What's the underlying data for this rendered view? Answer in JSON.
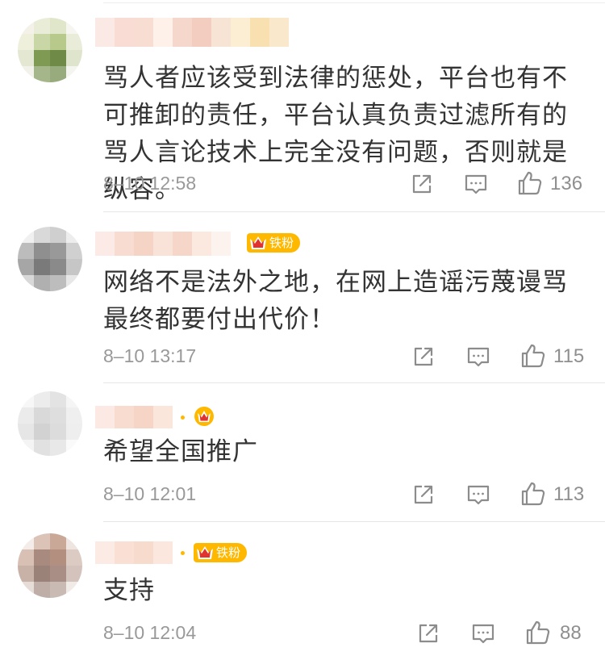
{
  "comments": [
    {
      "text": "骂人者应该受到法律的惩处，平台也有不可推卸的责任，平台认真负责过滤所有的骂人言论技术上完全没有问题，否则就是纵容。",
      "time": "8–10 12:58",
      "likes": "136",
      "badge": ""
    },
    {
      "text": "网络不是法外之地，在网上造谣污蔑谩骂最终都要付出代价！",
      "time": "8–10 13:17",
      "likes": "115",
      "badge": "铁粉"
    },
    {
      "text": "希望全国推广",
      "time": "8–10 12:01",
      "likes": "113",
      "badge": ""
    },
    {
      "text": "支持",
      "time": "8–10 12:04",
      "likes": "88",
      "badge": "铁粉"
    }
  ],
  "icons": {
    "share": "share-icon",
    "comment": "comment-icon",
    "like": "thumbs-up-icon",
    "crown": "crown-badge-icon"
  },
  "colors": {
    "text": "#333333",
    "meta": "#999999",
    "badge": "#ffb800"
  }
}
